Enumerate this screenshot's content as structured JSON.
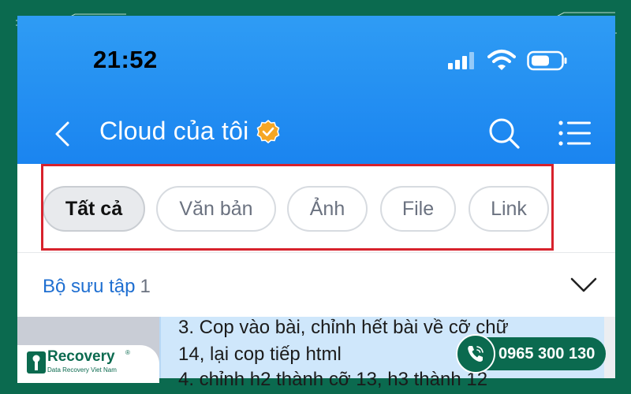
{
  "status_bar": {
    "time": "21:52",
    "icons": [
      "signal-icon",
      "wifi-icon",
      "battery-icon"
    ]
  },
  "header": {
    "title": "Cloud của tôi",
    "icons": [
      "back-icon",
      "verified-icon",
      "search-icon",
      "menu-icon"
    ]
  },
  "filters": {
    "items": [
      {
        "label": "Tất cả",
        "active": true
      },
      {
        "label": "Văn bản",
        "active": false
      },
      {
        "label": "Ảnh",
        "active": false
      },
      {
        "label": "File",
        "active": false
      },
      {
        "label": "Link",
        "active": false
      }
    ]
  },
  "collection": {
    "label": "Bộ sưu tập",
    "count": "1"
  },
  "note": {
    "line1": "3. Cop vào bài, chỉnh hết bài về cỡ chữ",
    "line2": "14, lại cop tiếp html",
    "line3": "4. chỉnh h2 thành cỡ 13, h3 thành 12"
  },
  "brand": {
    "name": "Recovery",
    "reg_mark": "®",
    "tagline": "Data Recovery Viet Nam"
  },
  "contact": {
    "phone": "0965 300 130"
  },
  "colors": {
    "brand_green": "#0b6a4f",
    "header_blue": "#1a84f0",
    "highlight_red": "#d7222c",
    "link_blue": "#1f6fd1",
    "verified_orange": "#f5a623"
  }
}
